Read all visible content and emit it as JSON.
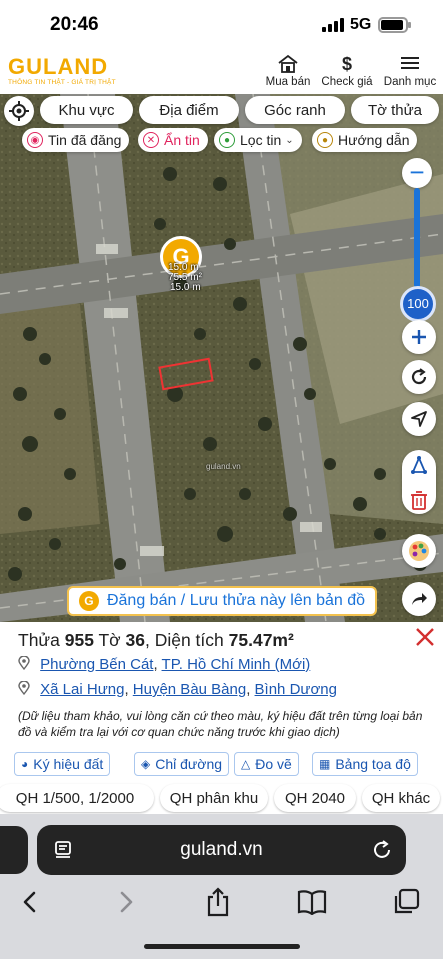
{
  "status": {
    "time": "20:46",
    "network": "5G"
  },
  "header": {
    "logo": "GULAND",
    "tagline": "THÔNG TIN THẬT - GIÁ TRỊ THẬT",
    "nav": [
      {
        "label": "Mua bán",
        "icon": "house-icon"
      },
      {
        "label": "Check giá",
        "icon": "dollar-icon"
      },
      {
        "label": "Danh mục",
        "icon": "menu-icon"
      }
    ]
  },
  "map_filters": [
    "Khu vực",
    "Địa điểm",
    "Góc ranh",
    "Tờ thửa"
  ],
  "map_toggles": [
    {
      "label": "Tin đã đăng",
      "icon": "posted-icon",
      "color": "#e0245e"
    },
    {
      "label": "Ẩn tin",
      "icon": "hide-icon",
      "color": "#e0245e"
    },
    {
      "label": "Lọc tin",
      "icon": "filter-pin-icon",
      "color": "#2e9d3a"
    },
    {
      "label": "Hướng dẫn",
      "icon": "guide-icon",
      "color": "#b8860b"
    }
  ],
  "zoom": {
    "level": "100"
  },
  "parcel": {
    "dim_top": "15.0 m",
    "area_label": "75.5 m²",
    "dim_bottom": "15.0 m"
  },
  "map_watermark": "guland.vn",
  "post_banner": "Đăng bán / Lưu thửa này lên bản đồ",
  "info": {
    "title_prefix": "Thửa ",
    "parcel_no": "955",
    "sheet_prefix": " Tờ ",
    "sheet_no": "36",
    "area_prefix": ", Diện tích ",
    "area": "75.47m²",
    "address_new": {
      "ward": "Phường Bến Cát",
      "sep": ", ",
      "city": "TP. Hồ Chí Minh (Mới)"
    },
    "address_old": {
      "commune": "Xã Lai Hưng",
      "sep1": ", ",
      "district": "Huyện Bàu Bàng",
      "sep2": ", ",
      "province": "Bình Dương"
    },
    "disclaimer": "(Dữ liệu tham khảo, vui lòng căn cứ theo màu, ký hiệu đất trên từng loại bản đồ và kiểm tra lại với cơ quan chức năng trước khi giao dịch)",
    "actions": [
      {
        "label": "Ký hiệu đất",
        "icon": "palette-icon"
      },
      {
        "label": "Chỉ đường",
        "icon": "directions-icon"
      },
      {
        "label": "Đo vẽ",
        "icon": "measure-icon"
      },
      {
        "label": "Bảng tọa độ",
        "icon": "table-icon"
      }
    ]
  },
  "planning": [
    "QH 1/500, 1/2000",
    "QH phân khu",
    "QH 2040",
    "QH khác"
  ],
  "browser": {
    "url": "guland.vn"
  }
}
